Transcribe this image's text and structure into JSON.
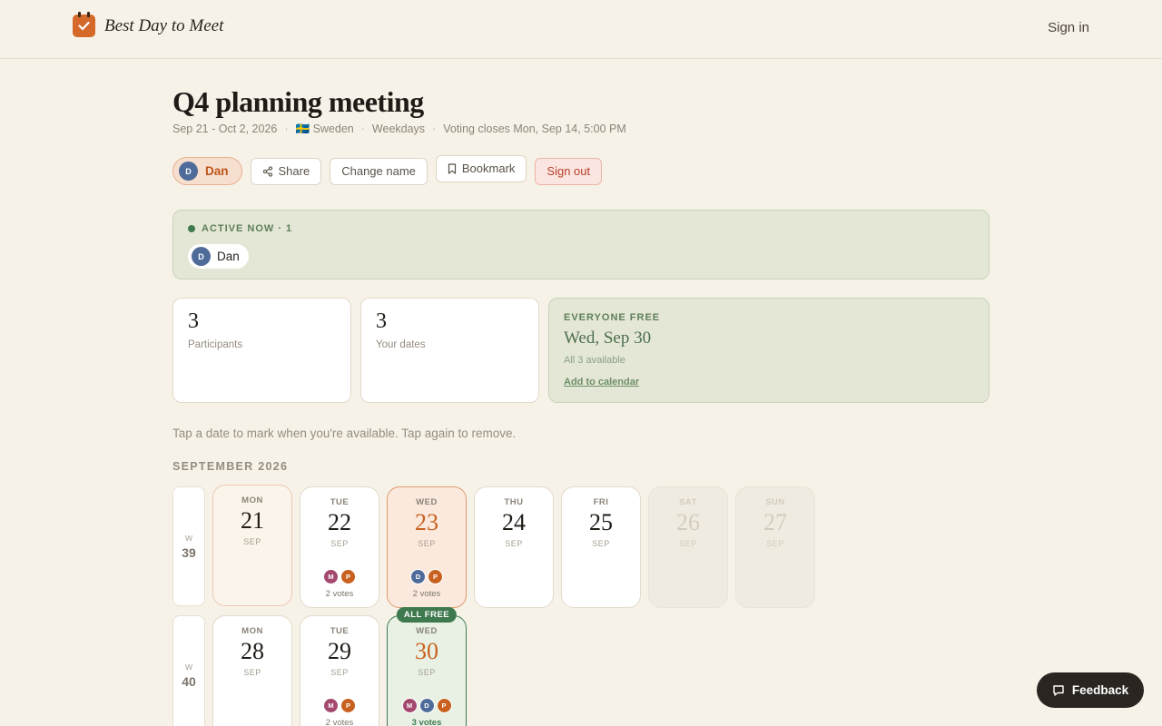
{
  "header": {
    "app_name": "Best Day to Meet",
    "signin_label": "Sign in"
  },
  "event": {
    "title": "Q4 planning meeting",
    "date_range": "Sep 21 - Oct 2, 2026",
    "country": "🇸🇪 Sweden",
    "days_mode": "Weekdays",
    "voting_closes": "Voting closes Mon, Sep 14, 5:00 PM"
  },
  "actions": {
    "user_name": "Dan",
    "user_initial": "D",
    "share_label": "Share",
    "change_name_label": "Change name",
    "bookmark_label": "Bookmark",
    "signout_label": "Sign out"
  },
  "active_now": {
    "label": "ACTIVE NOW · 1",
    "users": [
      {
        "initial": "D",
        "name": "Dan"
      }
    ]
  },
  "stats": {
    "participants": {
      "value": "3",
      "label": "Participants"
    },
    "your_dates": {
      "value": "3",
      "label": "Your dates"
    },
    "everyone_free": {
      "title": "EVERYONE FREE",
      "date": "Wed, Sep 30",
      "subtitle": "All 3 available",
      "link": "Add to calendar"
    }
  },
  "hint": "Tap a date to mark when you're available. Tap again to remove.",
  "month_label": "SEPTEMBER 2026",
  "weeks": [
    {
      "w_label": "W",
      "number": "39",
      "days": [
        {
          "dow": "MON",
          "num": "21",
          "mon": "SEP",
          "state": "today",
          "voters": [],
          "votes": ""
        },
        {
          "dow": "TUE",
          "num": "22",
          "mon": "SEP",
          "state": "",
          "voters": [
            "M",
            "P"
          ],
          "votes": "2 votes"
        },
        {
          "dow": "WED",
          "num": "23",
          "mon": "SEP",
          "state": "selected",
          "voters": [
            "D",
            "P"
          ],
          "votes": "2 votes"
        },
        {
          "dow": "THU",
          "num": "24",
          "mon": "SEP",
          "state": "",
          "voters": [],
          "votes": ""
        },
        {
          "dow": "FRI",
          "num": "25",
          "mon": "SEP",
          "state": "",
          "voters": [],
          "votes": ""
        },
        {
          "dow": "SAT",
          "num": "26",
          "mon": "SEP",
          "state": "weekend",
          "voters": [],
          "votes": ""
        },
        {
          "dow": "SUN",
          "num": "27",
          "mon": "SEP",
          "state": "weekend",
          "voters": [],
          "votes": ""
        }
      ]
    },
    {
      "w_label": "W",
      "number": "40",
      "days": [
        {
          "dow": "MON",
          "num": "28",
          "mon": "SEP",
          "state": "",
          "voters": [],
          "votes": ""
        },
        {
          "dow": "TUE",
          "num": "29",
          "mon": "SEP",
          "state": "",
          "voters": [
            "M",
            "P"
          ],
          "votes": "2 votes"
        },
        {
          "dow": "WED",
          "num": "30",
          "mon": "SEP",
          "state": "allfree",
          "badge": "ALL FREE",
          "voters": [
            "M",
            "D",
            "P"
          ],
          "votes": "3 votes"
        }
      ]
    }
  ],
  "feedback_label": "Feedback",
  "colors": {
    "accent": "#c8611f",
    "green": "#3f7a4f",
    "background": "#f7f2e8"
  }
}
